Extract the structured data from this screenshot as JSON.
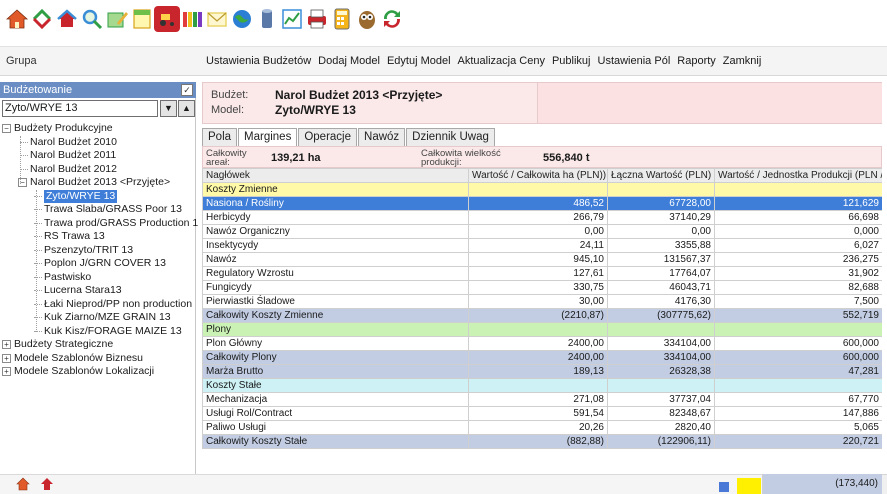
{
  "toolbar": {
    "icons": [
      {
        "name": "home-icon",
        "color": "#e05a2a"
      },
      {
        "name": "refresh-icon",
        "color": "#2f9e44"
      },
      {
        "name": "house-arrows-icon",
        "color": "#3a8ed8"
      },
      {
        "name": "zoom-icon",
        "color": "#3a8ed8"
      },
      {
        "name": "pencil-icon",
        "color": "#2f9e44"
      },
      {
        "name": "notes-icon",
        "color": "#d9a31a"
      },
      {
        "name": "tractor-icon",
        "color": "#c9252c"
      },
      {
        "name": "columns-icon",
        "color": "#7a3bc2"
      },
      {
        "name": "mail-icon",
        "color": "#e8d56a"
      },
      {
        "name": "globe-icon",
        "color": "#2a7fd4"
      },
      {
        "name": "cylinder-icon",
        "color": "#5b79a8"
      },
      {
        "name": "chart-icon",
        "color": "#3a8ed8"
      },
      {
        "name": "print-icon",
        "color": "#c9252c"
      },
      {
        "name": "calculator-icon",
        "color": "#6c6c6c"
      },
      {
        "name": "owl-icon",
        "color": "#9a6a2e"
      },
      {
        "name": "sync-icon",
        "color": "#2f9e44"
      }
    ]
  },
  "menubar": {
    "group_label": "Grupa",
    "items": [
      "Ustawienia Budżetów",
      "Dodaj Model",
      "Edytuj Model",
      "Aktualizacja Ceny",
      "Publikuj",
      "Ustawienia Pól",
      "Raporty",
      "Zamknij"
    ]
  },
  "sidebar": {
    "header": "Budżetowanie",
    "check_glyph": "✓",
    "selected_model": "Zyto/WRYE 13",
    "tree": [
      {
        "label": "Budżety Produkcyjne",
        "level": 0,
        "expander": "−"
      },
      {
        "label": "Narol Budżet 2010",
        "level": 1
      },
      {
        "label": "Narol Budżet 2011",
        "level": 1
      },
      {
        "label": "Narol Budżet 2012",
        "level": 1
      },
      {
        "label": "Narol Budżet 2013 <Przyjęte>",
        "level": 1,
        "expander": "−"
      },
      {
        "label": "Zyto/WRYE 13",
        "level": 2,
        "selected": true
      },
      {
        "label": "Trawa Slaba/GRASS Poor 13",
        "level": 2
      },
      {
        "label": "Trawa prod/GRASS Production 1",
        "level": 2
      },
      {
        "label": "RS Trawa 13",
        "level": 2
      },
      {
        "label": "Pszenzyto/TRIT 13",
        "level": 2
      },
      {
        "label": "Poplon J/GRN COVER 13",
        "level": 2
      },
      {
        "label": "Pastwisko",
        "level": 2
      },
      {
        "label": "Lucerna Stara13",
        "level": 2
      },
      {
        "label": "Łaki Nieprod/PP non production",
        "level": 2
      },
      {
        "label": "Kuk Ziarno/MZE GRAIN 13",
        "level": 2
      },
      {
        "label": "Kuk Kisz/FORAGE MAIZE 13",
        "level": 2
      },
      {
        "label": "Budżety Strategiczne",
        "level": 0,
        "expander": "+"
      },
      {
        "label": "Modele Szablonów Biznesu",
        "level": 0,
        "expander": "+"
      },
      {
        "label": "Modele Szablonów Lokalizacji",
        "level": 0,
        "expander": "+"
      }
    ]
  },
  "budget": {
    "budget_label": "Budżet:",
    "budget_value": "Narol Budżet 2013 <Przyjęte>",
    "model_label": "Model:",
    "model_value": "Zyto/WRYE 13"
  },
  "tabs": [
    "Pola",
    "Margines",
    "Operacje",
    "Nawóz",
    "Dziennik Uwag"
  ],
  "active_tab": "Margines",
  "summary": {
    "area_label_1": "Całkowity",
    "area_label_2": "areał:",
    "area_value": "139,21 ha",
    "prod_label_1": "Całkowita wielkość",
    "prod_label_2": "produkcji:",
    "prod_value": "556,840 t"
  },
  "grid": {
    "columns": [
      "Nagłówek",
      "Wartość / Całkowita  ha (PLN))",
      "Łączna Wartość (PLN)",
      "Wartość / Jednostka Produkcji (PLN / t)"
    ],
    "rows": [
      {
        "type": "sec-yellow",
        "cells": [
          "Koszty Zmienne",
          "",
          "",
          ""
        ]
      },
      {
        "type": "selrow",
        "cells": [
          "Nasiona / Rośliny",
          "486,52",
          "67728,00",
          "121,629"
        ]
      },
      {
        "type": "",
        "cells": [
          "Herbicydy",
          "266,79",
          "37140,29",
          "66,698"
        ]
      },
      {
        "type": "",
        "cells": [
          "Nawóz Organiczny",
          "0,00",
          "0,00",
          "0,000"
        ]
      },
      {
        "type": "",
        "cells": [
          "Insektycydy",
          "24,11",
          "3355,88",
          "6,027"
        ]
      },
      {
        "type": "",
        "cells": [
          "Nawóz",
          "945,10",
          "131567,37",
          "236,275"
        ]
      },
      {
        "type": "",
        "cells": [
          "Regulatory Wzrostu",
          "127,61",
          "17764,07",
          "31,902"
        ]
      },
      {
        "type": "",
        "cells": [
          "Fungicydy",
          "330,75",
          "46043,71",
          "82,688"
        ]
      },
      {
        "type": "",
        "cells": [
          "Pierwiastki Śladowe",
          "30,00",
          "4176,30",
          "7,500"
        ]
      },
      {
        "type": "total",
        "cells": [
          "Całkowity Koszty Zmienne",
          "(2210,87)",
          "(307775,62)",
          "552,719"
        ]
      },
      {
        "type": "sec-green",
        "cells": [
          "Plony",
          "",
          "",
          ""
        ]
      },
      {
        "type": "",
        "cells": [
          "Plon Główny",
          "2400,00",
          "334104,00",
          "600,000"
        ]
      },
      {
        "type": "total",
        "cells": [
          "Całkowity Plony",
          "2400,00",
          "334104,00",
          "600,000"
        ]
      },
      {
        "type": "total",
        "cells": [
          "Marża Brutto",
          "189,13",
          "26328,38",
          "47,281"
        ]
      },
      {
        "type": "sec-cyan",
        "cells": [
          "Koszty Stałe",
          "",
          "",
          ""
        ]
      },
      {
        "type": "",
        "cells": [
          "Mechanizacja",
          "271,08",
          "37737,04",
          "67,770"
        ]
      },
      {
        "type": "",
        "cells": [
          "Usługi Rol/Contract",
          "591,54",
          "82348,67",
          "147,886"
        ]
      },
      {
        "type": "",
        "cells": [
          "Paliwo Usługi",
          "20,26",
          "2820,40",
          "5,065"
        ]
      },
      {
        "type": "total",
        "cells": [
          "Całkowity Koszty Stałe",
          "(882,88)",
          "(122906,11)",
          "220,721"
        ]
      }
    ]
  },
  "statusbar": {
    "last_value": "(173,440)"
  }
}
